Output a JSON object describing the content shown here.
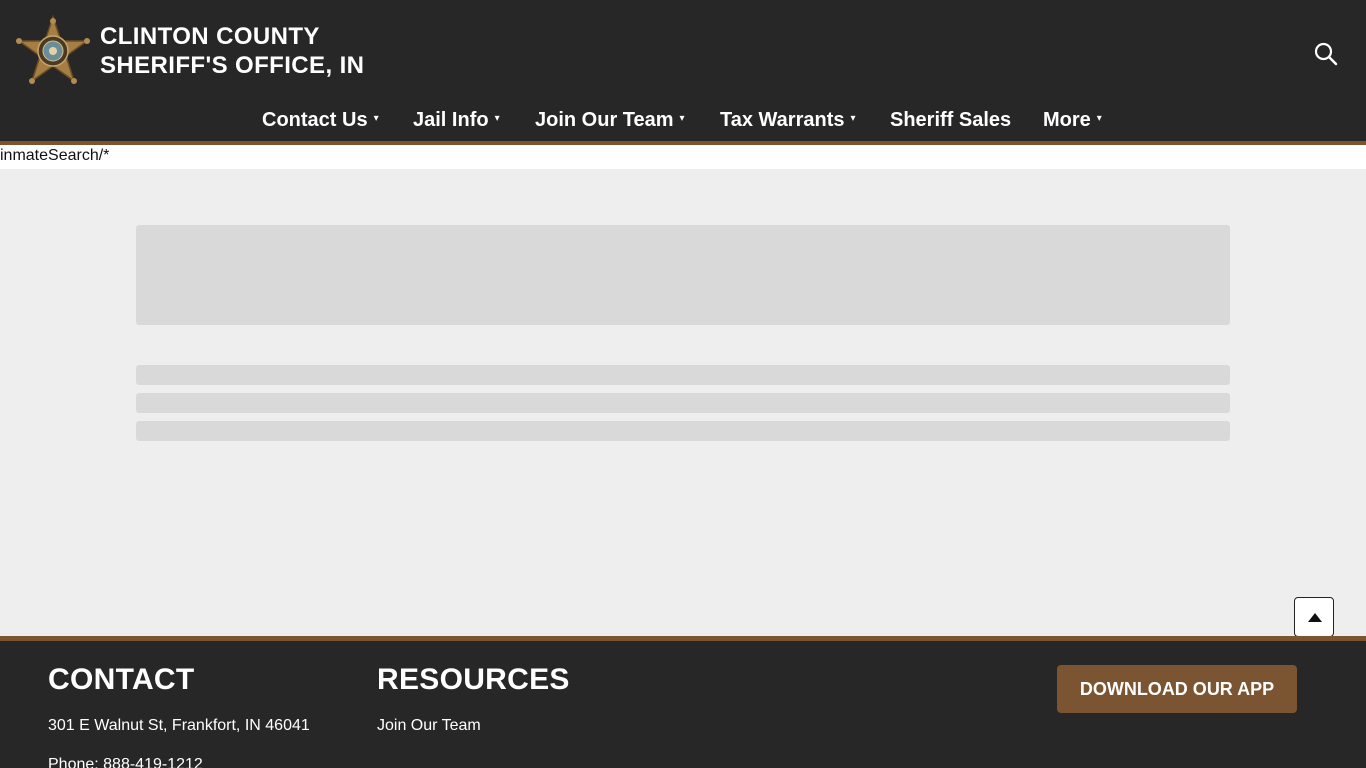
{
  "header": {
    "title_line1": "CLINTON COUNTY",
    "title_line2": "SHERIFF'S OFFICE, IN",
    "logo_icon": "sheriff-star-badge",
    "search_icon": "search-icon"
  },
  "nav": {
    "items": [
      {
        "label": "Contact Us",
        "has_dropdown": true
      },
      {
        "label": "Jail Info",
        "has_dropdown": true
      },
      {
        "label": "Join Our Team",
        "has_dropdown": true
      },
      {
        "label": "Tax Warrants",
        "has_dropdown": true
      },
      {
        "label": "Sheriff Sales",
        "has_dropdown": false
      },
      {
        "label": "More",
        "has_dropdown": true
      }
    ],
    "caret": "▾"
  },
  "content": {
    "path_text": "inmateSearch/*"
  },
  "footer": {
    "contact_heading": "CONTACT",
    "address": "301 E Walnut St, Frankfort, IN 46041",
    "phone": "Phone: 888-419-1212",
    "resources_heading": "RESOURCES",
    "resource_link": "Join Our Team",
    "app_button": "DOWNLOAD OUR APP"
  },
  "colors": {
    "header_bg": "#272727",
    "accent_brown": "#7b5531",
    "content_bg": "#eeeeee",
    "skeleton": "#d9d9d9"
  }
}
